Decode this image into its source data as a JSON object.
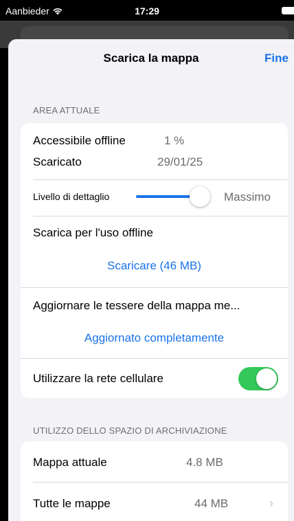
{
  "status_bar": {
    "carrier": "Aanbieder",
    "time": "17:29"
  },
  "nav": {
    "title": "Scarica la mappa",
    "done_label": "Fine"
  },
  "current_area": {
    "section_title": "AREA ATTUALE",
    "offline_label": "Accessibile offline",
    "offline_value": "1 %",
    "downloaded_label": "Scaricato",
    "downloaded_value": "29/01/25",
    "detail_label": "Livello di dettaglio",
    "detail_value": "Massimo",
    "detail_level_fraction": 0.85,
    "offline_use_label": "Scarica per l'uso offline",
    "download_action": "Scaricare (46 MB)",
    "update_tiles_label": "Aggiornare le tessere della mappa me...",
    "update_status": "Aggiornato completamente",
    "cellular_label": "Utilizzare la rete cellulare",
    "cellular_enabled": true
  },
  "storage": {
    "section_title": "UTILIZZO DELLO SPAZIO DI ARCHIVIAZIONE",
    "current_map_label": "Mappa attuale",
    "current_map_value": "4.8 MB",
    "all_maps_label": "Tutte le mappe",
    "all_maps_value": "44 MB"
  },
  "colors": {
    "accent": "#1a73e8",
    "toggle_on": "#34c759",
    "background": "#f2f2f7"
  },
  "icons": [
    "wifi-icon",
    "battery-icon",
    "chevron-right-icon"
  ]
}
